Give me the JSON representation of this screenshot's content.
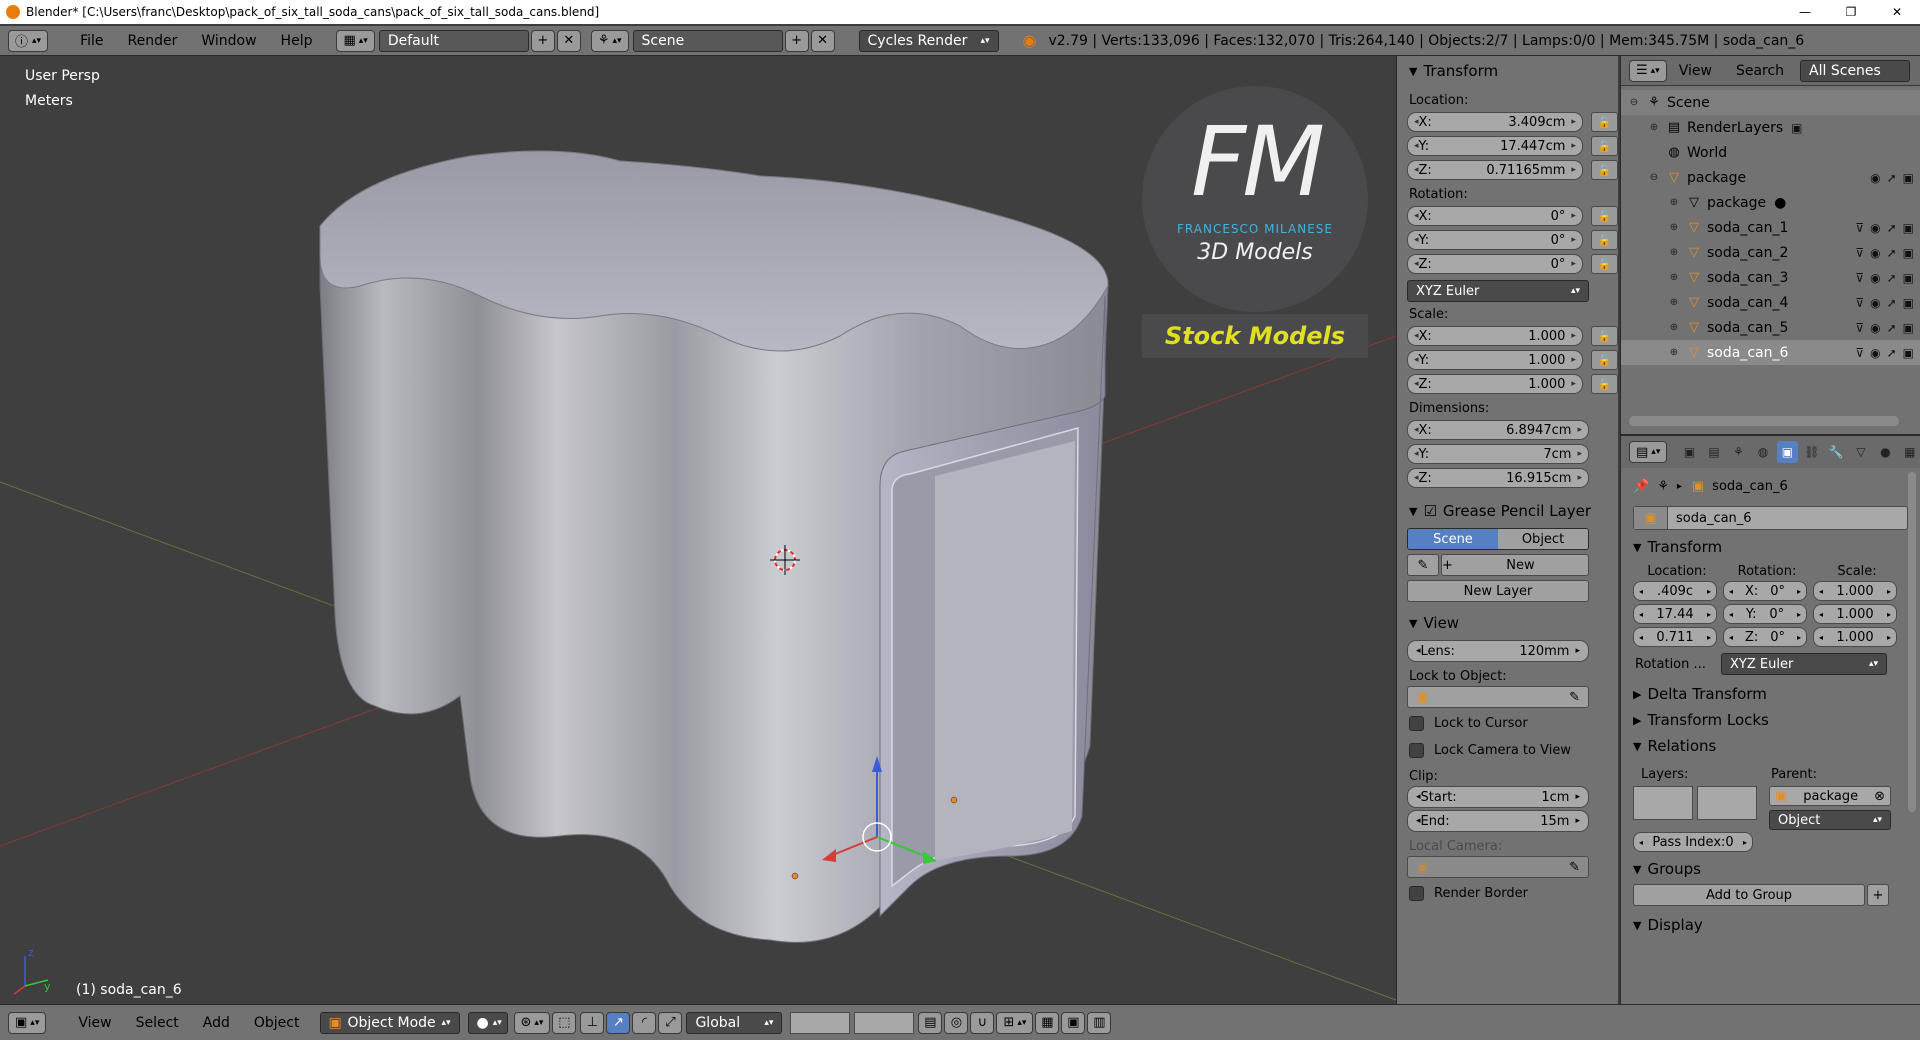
{
  "titlebar": {
    "title": "Blender* [C:\\Users\\franc\\Desktop\\pack_of_six_tall_soda_cans\\pack_of_six_tall_soda_cans.blend]",
    "minimize": "—",
    "maximize": "❐",
    "close": "✕"
  },
  "infobar": {
    "menus": [
      "File",
      "Render",
      "Window",
      "Help"
    ],
    "layout": "Default",
    "scene": "Scene",
    "engine": "Cycles Render",
    "stats": "v2.79 | Verts:133,096 | Faces:132,070 | Tris:264,140 | Objects:2/7 | Lamps:0/0 | Mem:345.75M | soda_can_6"
  },
  "viewport": {
    "view_name": "User Persp",
    "units": "Meters",
    "object_label": "(1) soda_can_6",
    "logo_letters": "FM",
    "logo_name": "FRANCESCO MILANESE",
    "logo_sub": "3D Models",
    "stock_label": "Stock Models"
  },
  "view_header": {
    "menus": [
      "View",
      "Select",
      "Add",
      "Object"
    ],
    "mode": "Object Mode",
    "orientation": "Global"
  },
  "npanel": {
    "transform_title": "Transform",
    "location_label": "Location:",
    "location": [
      {
        "axis": "X:",
        "value": "3.409cm"
      },
      {
        "axis": "Y:",
        "value": "17.447cm"
      },
      {
        "axis": "Z:",
        "value": "0.71165mm"
      }
    ],
    "rotation_label": "Rotation:",
    "rotation": [
      {
        "axis": "X:",
        "value": "0°"
      },
      {
        "axis": "Y:",
        "value": "0°"
      },
      {
        "axis": "Z:",
        "value": "0°"
      }
    ],
    "rotation_mode": "XYZ Euler",
    "scale_label": "Scale:",
    "scale": [
      {
        "axis": "X:",
        "value": "1.000"
      },
      {
        "axis": "Y:",
        "value": "1.000"
      },
      {
        "axis": "Z:",
        "value": "1.000"
      }
    ],
    "dimensions_label": "Dimensions:",
    "dimensions": [
      {
        "axis": "X:",
        "value": "6.8947cm"
      },
      {
        "axis": "Y:",
        "value": "7cm"
      },
      {
        "axis": "Z:",
        "value": "16.915cm"
      }
    ],
    "gp_title": "Grease Pencil Layer",
    "gp_scene": "Scene",
    "gp_object": "Object",
    "gp_new": "New",
    "gp_new_layer": "New Layer",
    "view_title": "View",
    "lens_label": "Lens:",
    "lens_value": "120mm",
    "lock_to_object": "Lock to Object:",
    "lock_to_cursor": "Lock to Cursor",
    "lock_camera": "Lock Camera to View",
    "clip_label": "Clip:",
    "clip_start_label": "Start:",
    "clip_start": "1cm",
    "clip_end_label": "End:",
    "clip_end": "15m",
    "local_camera": "Local Camera:",
    "render_border": "Render Border"
  },
  "outliner": {
    "menus": [
      "View",
      "Search"
    ],
    "filter": "All Scenes",
    "items": [
      {
        "label": "Scene",
        "level": 0
      },
      {
        "label": "RenderLayers",
        "level": 1
      },
      {
        "label": "World",
        "level": 1
      },
      {
        "label": "package",
        "level": 1
      },
      {
        "label": "package",
        "level": 2
      },
      {
        "label": "soda_can_1",
        "level": 2
      },
      {
        "label": "soda_can_2",
        "level": 2
      },
      {
        "label": "soda_can_3",
        "level": 2
      },
      {
        "label": "soda_can_4",
        "level": 2
      },
      {
        "label": "soda_can_5",
        "level": 2
      },
      {
        "label": "soda_can_6",
        "level": 2
      }
    ]
  },
  "properties": {
    "breadcrumb": "soda_can_6",
    "object_name": "soda_can_6",
    "transform_title": "Transform",
    "location_label": "Location:",
    "rotation_label": "Rotation:",
    "scale_label": "Scale:",
    "loc": [
      ".409c",
      "17.44",
      "0.711"
    ],
    "rot": [
      {
        "axis": "X:",
        "value": "0°"
      },
      {
        "axis": "Y:",
        "value": "0°"
      },
      {
        "axis": "Z:",
        "value": "0°"
      }
    ],
    "scl": [
      "1.000",
      "1.000",
      "1.000"
    ],
    "rotation_mode_label": "Rotation ...",
    "rotation_mode": "XYZ Euler",
    "delta_transform": "Delta Transform",
    "transform_locks": "Transform Locks",
    "relations": "Relations",
    "layers_label": "Layers:",
    "parent_label": "Parent:",
    "parent_value": "package",
    "parent_type": "Object",
    "pass_index": "Pass Index:0",
    "groups": "Groups",
    "add_to_group": "Add to Group",
    "display": "Display"
  }
}
